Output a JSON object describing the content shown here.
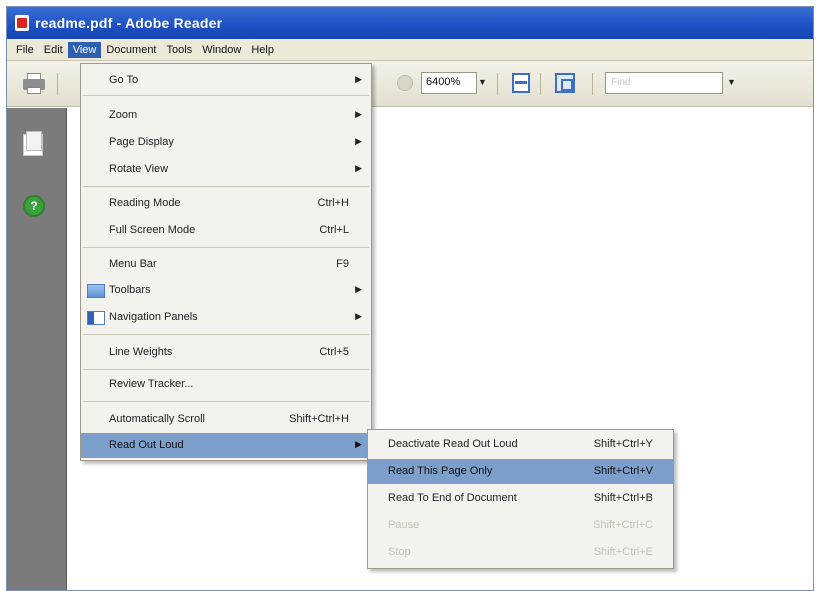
{
  "window": {
    "title": "readme.pdf - Adobe Reader"
  },
  "menubar": {
    "items": [
      {
        "label": "File"
      },
      {
        "label": "Edit"
      },
      {
        "label": "View"
      },
      {
        "label": "Document"
      },
      {
        "label": "Tools"
      },
      {
        "label": "Window"
      },
      {
        "label": "Help"
      }
    ]
  },
  "toolbar": {
    "zoom_value": "6400%",
    "find_placeholder": "Find"
  },
  "view_menu": {
    "items": [
      {
        "label": "Go To"
      },
      {
        "label": "Zoom"
      },
      {
        "label": "Page Display"
      },
      {
        "label": "Rotate View"
      },
      {
        "label": "Reading Mode",
        "shortcut": "Ctrl+H"
      },
      {
        "label": "Full Screen Mode",
        "shortcut": "Ctrl+L"
      },
      {
        "label": "Menu Bar",
        "shortcut": "F9"
      },
      {
        "label": "Toolbars"
      },
      {
        "label": "Navigation Panels"
      },
      {
        "label": "Line Weights",
        "shortcut": "Ctrl+5"
      },
      {
        "label": "Review Tracker..."
      },
      {
        "label": "Automatically Scroll",
        "shortcut": "Shift+Ctrl+H"
      },
      {
        "label": "Read Out Loud"
      }
    ]
  },
  "read_out_loud_menu": {
    "items": [
      {
        "label": "Deactivate Read Out Loud",
        "shortcut": "Shift+Ctrl+Y"
      },
      {
        "label": "Read This Page Only",
        "shortcut": "Shift+Ctrl+V"
      },
      {
        "label": "Read To End of Document",
        "shortcut": "Shift+Ctrl+B"
      },
      {
        "label": "Pause",
        "shortcut": "Shift+Ctrl+C"
      },
      {
        "label": "Stop",
        "shortcut": "Shift+Ctrl+E"
      }
    ]
  },
  "icons": {
    "app": "adobe-reader-icon",
    "print": "printer-icon",
    "fit_page": "fit-page-icon",
    "full_screen": "full-screen-icon",
    "pages_panel": "pages-icon",
    "help": "help-icon",
    "submenu_arrow": "submenu-arrow-icon"
  },
  "colors": {
    "titlebar": "#1c50c4",
    "menu_highlight": "#7d9fcc",
    "nav_pane": "#7b7b7b"
  }
}
